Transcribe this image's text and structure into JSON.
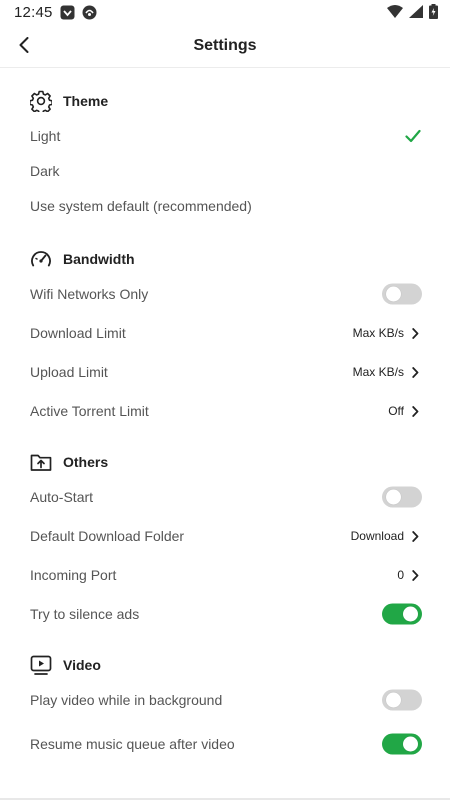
{
  "status_bar": {
    "time": "12:45",
    "icons": [
      "app-notification-icon",
      "app-notification-icon",
      "wifi-icon",
      "signal-icon",
      "battery-charging-icon"
    ]
  },
  "header": {
    "title": "Settings",
    "back_icon": "back-arrow-icon"
  },
  "sections": {
    "theme": {
      "title": "Theme",
      "icon": "gear-icon",
      "items": [
        {
          "label": "Light",
          "selected": true
        },
        {
          "label": "Dark",
          "selected": false
        },
        {
          "label": "Use system default (recommended)",
          "selected": false
        }
      ]
    },
    "bandwidth": {
      "title": "Bandwidth",
      "icon": "speedometer-icon",
      "items": [
        {
          "label": "Wifi Networks Only",
          "toggle": false
        },
        {
          "label": "Download Limit",
          "value": "Max KB/s"
        },
        {
          "label": "Upload Limit",
          "value": "Max KB/s"
        },
        {
          "label": "Active Torrent Limit",
          "value": "Off"
        }
      ]
    },
    "others": {
      "title": "Others",
      "icon": "folder-upload-icon",
      "items": [
        {
          "label": "Auto-Start",
          "toggle": false
        },
        {
          "label": "Default Download Folder",
          "value": "Download"
        },
        {
          "label": "Incoming Port",
          "value": "0"
        },
        {
          "label": "Try to silence ads",
          "toggle": true
        }
      ]
    },
    "video": {
      "title": "Video",
      "icon": "video-play-icon",
      "items": [
        {
          "label": "Play video while in background",
          "toggle": false
        },
        {
          "label": "Resume music queue after video",
          "toggle": true
        }
      ]
    }
  },
  "colors": {
    "accent_green": "#21a746",
    "toggle_off": "#d3d3d3",
    "label_gray": "#555555",
    "title_dark": "#222222"
  }
}
